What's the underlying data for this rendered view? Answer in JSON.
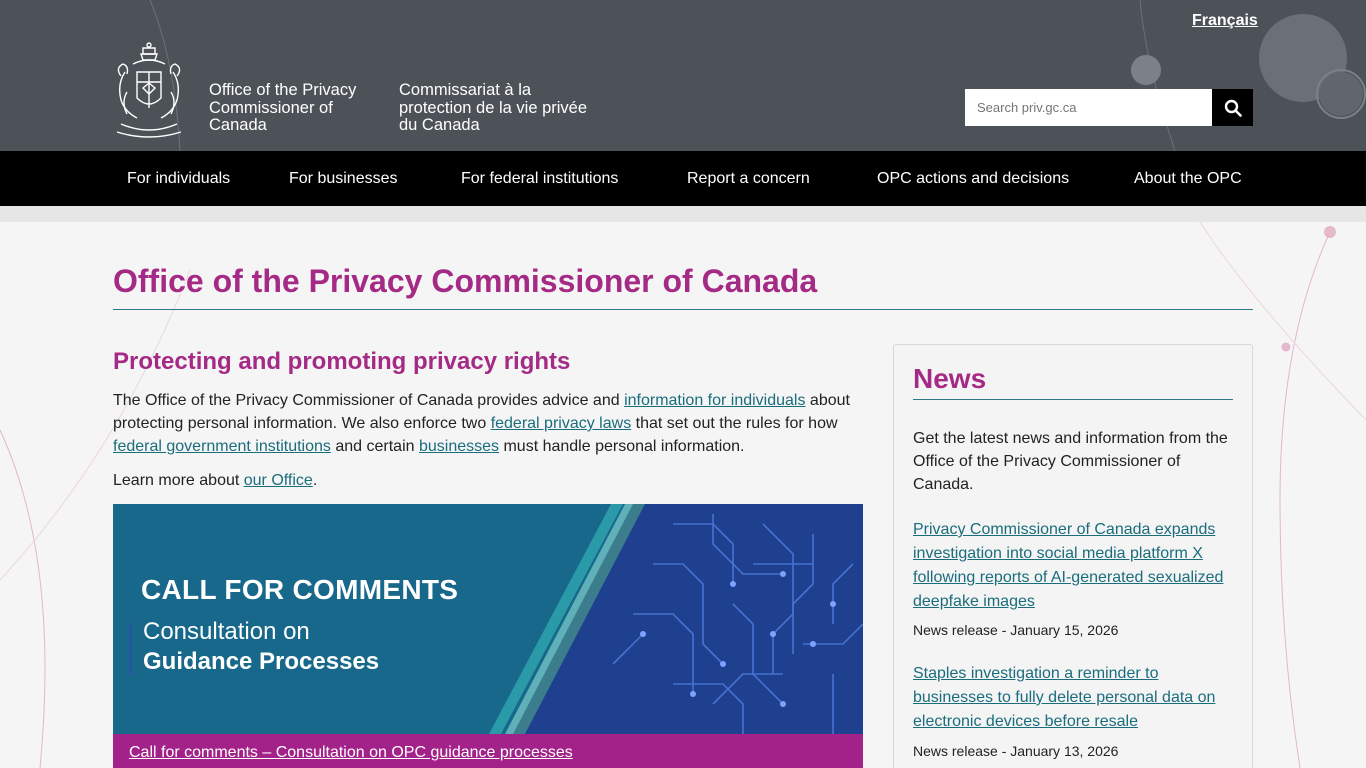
{
  "header": {
    "language_link": "Français",
    "org_name_en": "Office of the Privacy Commissioner of Canada",
    "org_name_fr": "Commissariat à la protection de la vie privée du Canada",
    "search": {
      "placeholder": "Search priv.gc.ca"
    }
  },
  "nav": {
    "items": [
      {
        "label": "For individuals"
      },
      {
        "label": "For businesses"
      },
      {
        "label": "For federal institutions"
      },
      {
        "label": "Report a concern"
      },
      {
        "label": "OPC actions and decisions"
      },
      {
        "label": "About the OPC"
      }
    ]
  },
  "main": {
    "page_title": "Office of the Privacy Commissioner of Canada",
    "section_title": "Protecting and promoting privacy rights",
    "intro": {
      "t1": "The Office of the Privacy Commissioner of Canada provides advice and ",
      "link1": "information for individuals",
      "t2": " about protecting personal information. We also enforce two ",
      "link2": "federal privacy laws",
      "t3": " that set out the rules for how ",
      "link3": "federal government institutions",
      "t4": " and certain ",
      "link4": "businesses",
      "t5": " must handle personal information."
    },
    "learn_more": {
      "text": "Learn more about ",
      "link": "our Office",
      "end": "."
    },
    "banner": {
      "title": "CALL FOR COMMENTS",
      "subtitle_line1": "Consultation on",
      "subtitle_line2": "Guidance Processes",
      "caption_link": "Call for comments – Consultation on OPC guidance processes"
    }
  },
  "news": {
    "title": "News",
    "intro": "Get the latest news and information from the Office of the Privacy Commissioner of Canada.",
    "items": [
      {
        "title": "Privacy Commissioner of Canada expands investigation into social media platform X following reports of AI-generated sexualized deepfake images",
        "meta": "News release - January 15, 2026"
      },
      {
        "title": "Staples investigation a reminder to businesses to fully delete personal data on electronic devices before resale",
        "meta": "News release - January 13, 2026"
      }
    ]
  },
  "colors": {
    "header_bg": "#4c5257",
    "nav_bg": "#000000",
    "accent_magenta": "#a52a85",
    "link_teal": "#1a6d7c",
    "banner_blue": "#17688a",
    "caption_magenta": "#a3228a"
  },
  "icons": {
    "search": "magnifier-icon",
    "crest": "canada-coat-of-arms-icon"
  }
}
